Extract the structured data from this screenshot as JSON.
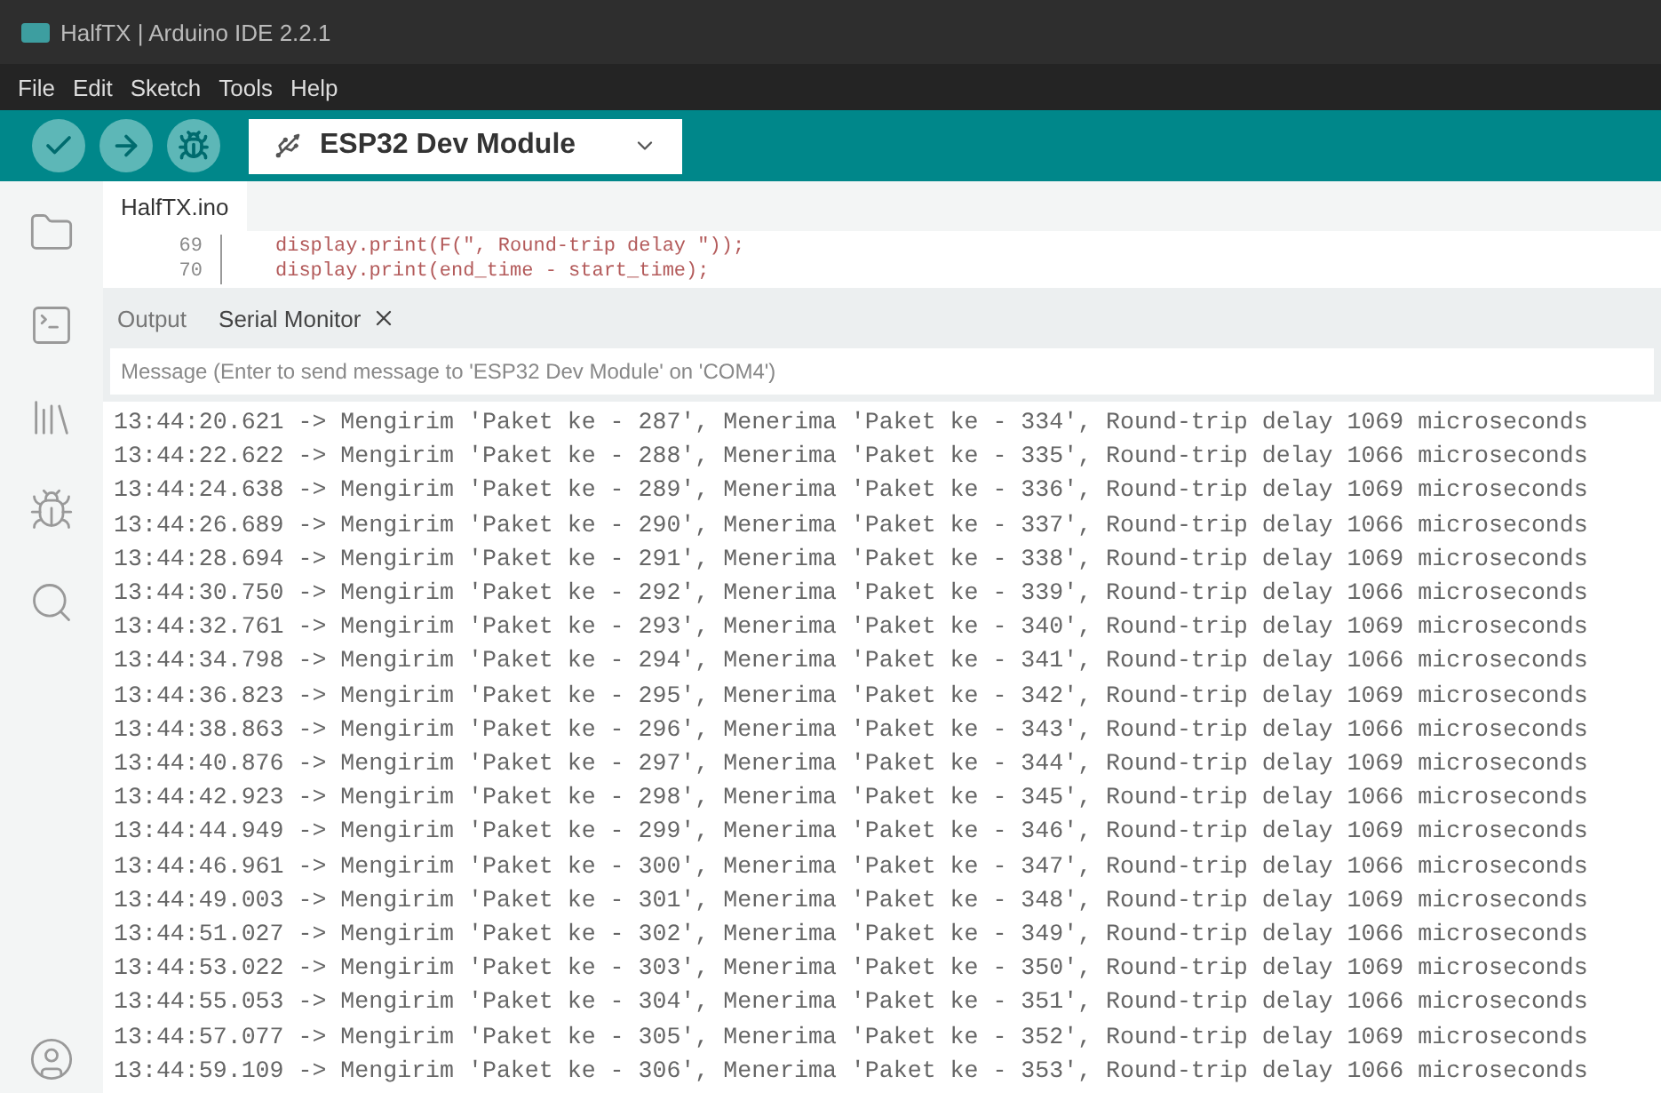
{
  "window": {
    "title": "HalfTX | Arduino IDE 2.2.1"
  },
  "menu": [
    "File",
    "Edit",
    "Sketch",
    "Tools",
    "Help"
  ],
  "toolbar": {
    "board": "ESP32 Dev Module",
    "buttons": [
      {
        "kind": "verify"
      },
      {
        "kind": "upload"
      },
      {
        "kind": "debug"
      }
    ]
  },
  "sidebar": {
    "items": [
      {
        "kind": "folder",
        "selected": false
      },
      {
        "kind": "boards",
        "selected": false
      },
      {
        "kind": "library",
        "selected": false
      },
      {
        "kind": "debug",
        "selected": false
      },
      {
        "kind": "search",
        "selected": false
      }
    ],
    "bottom": {
      "kind": "profile"
    }
  },
  "editor": {
    "tabs": [
      {
        "label": "HalfTX.ino",
        "selected": true
      }
    ],
    "lines": [
      {
        "number": "69",
        "code": "display.print(F(\", Round-trip delay \"));"
      },
      {
        "number": "70",
        "code": "display.print(end_time - start_time);"
      }
    ]
  },
  "panel": {
    "tabs": [
      {
        "label": "Output",
        "selected": false,
        "closable": false
      },
      {
        "label": "Serial Monitor",
        "selected": true,
        "closable": true
      }
    ],
    "message": {
      "placeholder": "Message (Enter to send message to 'ESP32 Dev Module' on 'COM4')"
    },
    "log": [
      "13:44:20.621 -> Mengirim 'Paket ke - 287', Menerima 'Paket ke - 334', Round-trip delay 1069 microseconds",
      "13:44:22.622 -> Mengirim 'Paket ke - 288', Menerima 'Paket ke - 335', Round-trip delay 1066 microseconds",
      "13:44:24.638 -> Mengirim 'Paket ke - 289', Menerima 'Paket ke - 336', Round-trip delay 1069 microseconds",
      "13:44:26.689 -> Mengirim 'Paket ke - 290', Menerima 'Paket ke - 337', Round-trip delay 1066 microseconds",
      "13:44:28.694 -> Mengirim 'Paket ke - 291', Menerima 'Paket ke - 338', Round-trip delay 1069 microseconds",
      "13:44:30.750 -> Mengirim 'Paket ke - 292', Menerima 'Paket ke - 339', Round-trip delay 1066 microseconds",
      "13:44:32.761 -> Mengirim 'Paket ke - 293', Menerima 'Paket ke - 340', Round-trip delay 1069 microseconds",
      "13:44:34.798 -> Mengirim 'Paket ke - 294', Menerima 'Paket ke - 341', Round-trip delay 1066 microseconds",
      "13:44:36.823 -> Mengirim 'Paket ke - 295', Menerima 'Paket ke - 342', Round-trip delay 1069 microseconds",
      "13:44:38.863 -> Mengirim 'Paket ke - 296', Menerima 'Paket ke - 343', Round-trip delay 1066 microseconds",
      "13:44:40.876 -> Mengirim 'Paket ke - 297', Menerima 'Paket ke - 344', Round-trip delay 1069 microseconds",
      "13:44:42.923 -> Mengirim 'Paket ke - 298', Menerima 'Paket ke - 345', Round-trip delay 1066 microseconds",
      "13:44:44.949 -> Mengirim 'Paket ke - 299', Menerima 'Paket ke - 346', Round-trip delay 1069 microseconds",
      "13:44:46.961 -> Mengirim 'Paket ke - 300', Menerima 'Paket ke - 347', Round-trip delay 1066 microseconds",
      "13:44:49.003 -> Mengirim 'Paket ke - 301', Menerima 'Paket ke - 348', Round-trip delay 1069 microseconds",
      "13:44:51.027 -> Mengirim 'Paket ke - 302', Menerima 'Paket ke - 349', Round-trip delay 1066 microseconds",
      "13:44:53.022 -> Mengirim 'Paket ke - 303', Menerima 'Paket ke - 350', Round-trip delay 1069 microseconds",
      "13:44:55.053 -> Mengirim 'Paket ke - 304', Menerima 'Paket ke - 351', Round-trip delay 1066 microseconds",
      "13:44:57.077 -> Mengirim 'Paket ke - 305', Menerima 'Paket ke - 352', Round-trip delay 1069 microseconds",
      "13:44:59.109 -> Mengirim 'Paket ke - 306', Menerima 'Paket ke - 353', Round-trip delay 1066 microseconds"
    ]
  }
}
